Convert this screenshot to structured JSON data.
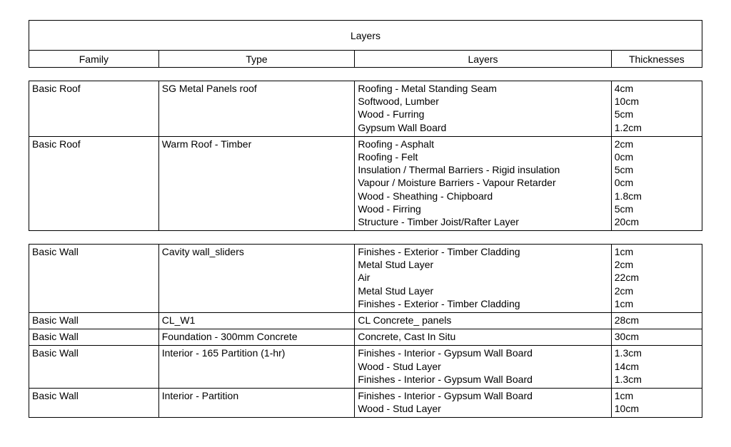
{
  "title": "Layers",
  "columns": [
    "Family",
    "Type",
    "Layers",
    "Thicknesses"
  ],
  "group1": [
    {
      "family": "Basic Roof",
      "type": "SG Metal Panels roof",
      "layers": "Roofing - Metal Standing Seam\nSoftwood, Lumber\nWood - Furring\nGypsum Wall Board",
      "thick": "4cm\n10cm\n5cm\n1.2cm"
    },
    {
      "family": "Basic Roof",
      "type": "Warm Roof - Timber",
      "layers": "Roofing - Asphalt\nRoofing - Felt\nInsulation / Thermal Barriers - Rigid insulation\nVapour / Moisture Barriers - Vapour Retarder\nWood - Sheathing - Chipboard\nWood - Firring\nStructure - Timber Joist/Rafter Layer",
      "thick": "2cm\n0cm\n5cm\n0cm\n1.8cm\n5cm\n20cm"
    }
  ],
  "group2": [
    {
      "family": "Basic Wall",
      "type": "Cavity wall_sliders",
      "layers": "Finishes - Exterior - Timber Cladding\nMetal Stud Layer\nAir\nMetal Stud Layer\nFinishes - Exterior - Timber Cladding",
      "thick": "1cm\n2cm\n22cm\n2cm\n1cm"
    },
    {
      "family": "Basic Wall",
      "type": "CL_W1",
      "layers": "CL Concrete_ panels",
      "thick": "28cm"
    },
    {
      "family": "Basic Wall",
      "type": "Foundation - 300mm Concrete",
      "layers": "Concrete, Cast In Situ",
      "thick": "30cm"
    },
    {
      "family": "Basic Wall",
      "type": "Interior - 165 Partition (1-hr)",
      "layers": "Finishes - Interior - Gypsum Wall Board\nWood - Stud Layer\nFinishes - Interior - Gypsum Wall Board",
      "thick": "1.3cm\n14cm\n1.3cm"
    },
    {
      "family": "Basic Wall",
      "type": "Interior - Partition",
      "layers": "Finishes - Interior - Gypsum Wall Board\nWood - Stud Layer",
      "thick": "1cm\n10cm"
    }
  ]
}
